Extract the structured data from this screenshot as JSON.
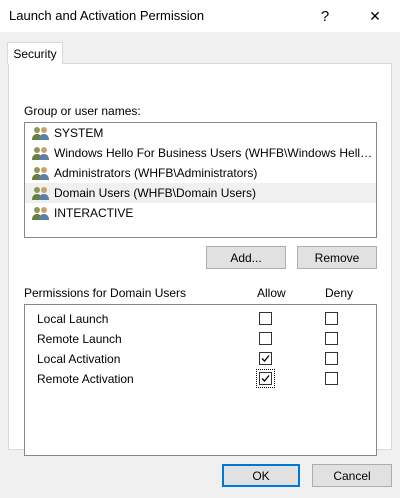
{
  "window": {
    "title": "Launch and Activation Permission",
    "help_glyph": "?",
    "close_glyph": "✕"
  },
  "tabs": [
    {
      "label": "Security"
    }
  ],
  "groups": {
    "label": "Group or user names:",
    "items": [
      {
        "label": "SYSTEM",
        "icon": "users-icon"
      },
      {
        "label": "Windows Hello For Business Users (WHFB\\Windows Hello ...",
        "icon": "users-icon"
      },
      {
        "label": "Administrators (WHFB\\Administrators)",
        "icon": "users-icon"
      },
      {
        "label": "Domain Users (WHFB\\Domain Users)",
        "icon": "users-icon",
        "selected": true
      },
      {
        "label": "INTERACTIVE",
        "icon": "users-icon"
      }
    ]
  },
  "buttons": {
    "add": "Add...",
    "remove": "Remove",
    "ok": "OK",
    "cancel": "Cancel"
  },
  "permissions": {
    "header": "Permissions for Domain Users",
    "allow_label": "Allow",
    "deny_label": "Deny",
    "rows": [
      {
        "name": "Local Launch",
        "allow": false,
        "deny": false
      },
      {
        "name": "Remote Launch",
        "allow": false,
        "deny": false
      },
      {
        "name": "Local Activation",
        "allow": true,
        "deny": false
      },
      {
        "name": "Remote Activation",
        "allow": true,
        "deny": false,
        "focused": true
      }
    ]
  },
  "colors": {
    "accent": "#0078d7",
    "dialog_bg": "#f0f0f0",
    "selection_bg": "#f0f0f0"
  }
}
